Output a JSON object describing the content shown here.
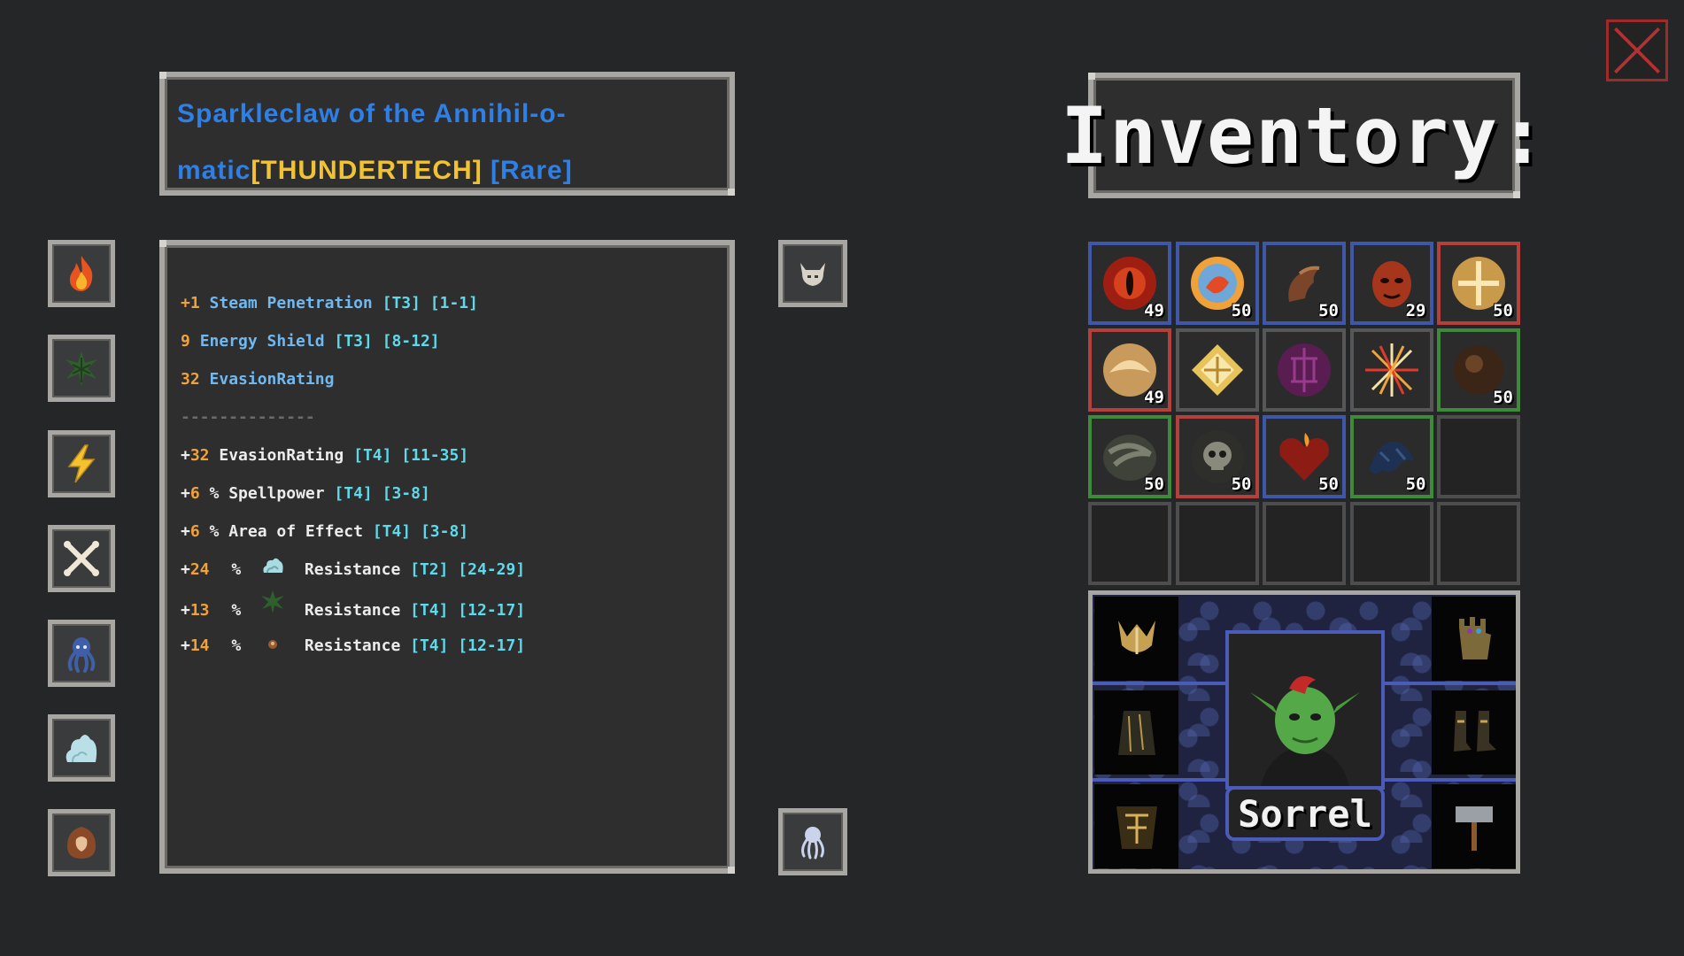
{
  "item": {
    "title_part1": "Sparkleclaw of the Annihil-o-",
    "title_part2": "matic",
    "brand": "[THUNDERTECH]",
    "rarity": "[Rare]",
    "colors": {
      "name": "#2e7fe6",
      "brand": "#f1c232",
      "rarity": "#2e7fe6"
    }
  },
  "stats": [
    {
      "prefix": "+1",
      "name": "Steam Penetration",
      "tier": "[T3] [1-1]"
    },
    {
      "prefix": "9",
      "name": "Energy Shield",
      "tier": "[T3] [8-12]"
    },
    {
      "prefix": "32",
      "name": "EvasionRating",
      "tier": ""
    }
  ],
  "separator": "--------------",
  "affixes": [
    {
      "plus": "+",
      "value": "32",
      "name": "EvasionRating",
      "tier": "[T4] [11-35]"
    },
    {
      "plus": "+",
      "value": "6",
      "name": "% Spellpower",
      "tier": "[T4] [3-8]"
    },
    {
      "plus": "+",
      "value": "6",
      "name": "% Area of Effect",
      "tier": "[T4] [3-8]"
    }
  ],
  "resistances": [
    {
      "plus": "+",
      "value": "24",
      "pct": "%",
      "icon": "ice-cloud-icon",
      "name": "Resistance",
      "tier": "[T2] [24-29]"
    },
    {
      "plus": "+",
      "value": "13",
      "pct": "%",
      "icon": "poison-leaf-icon",
      "name": "Resistance",
      "tier": "[T4] [12-17]"
    },
    {
      "plus": "+",
      "value": "14",
      "pct": "%",
      "icon": "nut-icon",
      "name": "Resistance",
      "tier": "[T4] [12-17]"
    }
  ],
  "element_icons": [
    "fire-icon",
    "poison-leaf-icon",
    "lightning-icon",
    "crossed-bones-icon",
    "octopus-icon",
    "ice-cloud-icon",
    "nut-icon"
  ],
  "slot_buttons": [
    "helmet-slot-icon",
    "tentacle-slot-icon"
  ],
  "inventory": {
    "title": "Inventory:",
    "slots": [
      {
        "icon": "red-eye-orb-icon",
        "qty": "49",
        "rarity": "blue"
      },
      {
        "icon": "fire-orb-icon",
        "qty": "50",
        "rarity": "blue"
      },
      {
        "icon": "claw-horn-icon",
        "qty": "50",
        "rarity": "blue"
      },
      {
        "icon": "demon-face-icon",
        "qty": "29",
        "rarity": "blue"
      },
      {
        "icon": "golden-cross-orb-icon",
        "qty": "50",
        "rarity": "red"
      },
      {
        "icon": "golden-shell-orb-icon",
        "qty": "49",
        "rarity": "red"
      },
      {
        "icon": "diamond-sigil-icon",
        "qty": "",
        "rarity": "grey"
      },
      {
        "icon": "purple-rune-orb-icon",
        "qty": "",
        "rarity": "grey"
      },
      {
        "icon": "starburst-icon",
        "qty": "",
        "rarity": "grey"
      },
      {
        "icon": "dark-orb-icon",
        "qty": "50",
        "rarity": "green"
      },
      {
        "icon": "swirl-stone-icon",
        "qty": "50",
        "rarity": "green"
      },
      {
        "icon": "skull-orb-icon",
        "qty": "50",
        "rarity": "red"
      },
      {
        "icon": "burning-heart-icon",
        "qty": "50",
        "rarity": "blue"
      },
      {
        "icon": "shadow-beast-icon",
        "qty": "50",
        "rarity": "green"
      },
      {
        "icon": "",
        "qty": "",
        "rarity": "empty"
      },
      {
        "icon": "",
        "qty": "",
        "rarity": "empty"
      },
      {
        "icon": "",
        "qty": "",
        "rarity": "empty"
      },
      {
        "icon": "",
        "qty": "",
        "rarity": "empty"
      },
      {
        "icon": "",
        "qty": "",
        "rarity": "empty"
      },
      {
        "icon": "",
        "qty": "",
        "rarity": "empty"
      }
    ]
  },
  "character": {
    "name": "Sorrel",
    "equipment": [
      "crown-helmet-icon",
      "gauntlet-icon",
      "cloak-icon",
      "boots-icon",
      "armor-icon",
      "hammer-icon"
    ]
  },
  "close_icon": "close-icon"
}
